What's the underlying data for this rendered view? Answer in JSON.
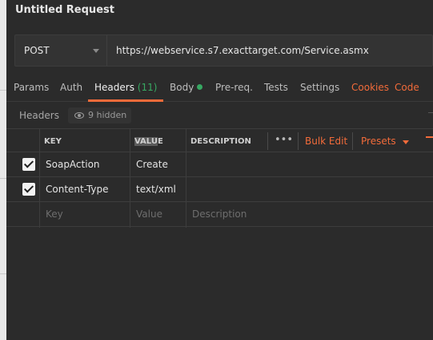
{
  "window": {
    "title": "Untitled Request"
  },
  "request": {
    "method": "POST",
    "url": "https://webservice.s7.exacttarget.com/Service.asmx"
  },
  "tabs": [
    {
      "label": "Params"
    },
    {
      "label": "Auth"
    },
    {
      "label": "Headers",
      "count": "(11)"
    },
    {
      "label": "Body"
    },
    {
      "label": "Pre-req."
    },
    {
      "label": "Tests"
    },
    {
      "label": "Settings"
    }
  ],
  "tab_links": {
    "cookies": "Cookies",
    "code": "Code"
  },
  "headers_bar": {
    "label": "Headers",
    "hidden": "9 hidden"
  },
  "table": {
    "columns": {
      "key": "KEY",
      "value_hl": "VALU",
      "value_rest": "E",
      "description": "DESCRIPTION"
    },
    "actions": {
      "more": "•••",
      "bulk_edit": "Bulk Edit",
      "presets": "Presets"
    },
    "rows": [
      {
        "key": "SoapAction",
        "value": "Create",
        "description": ""
      },
      {
        "key": "Content-Type",
        "value": "text/xml",
        "description": ""
      }
    ],
    "placeholder": {
      "key": "Key",
      "value": "Value",
      "description": "Description"
    }
  },
  "colors": {
    "accent": "#f26b3a",
    "success": "#37a862",
    "background": "#2b2b2b"
  }
}
